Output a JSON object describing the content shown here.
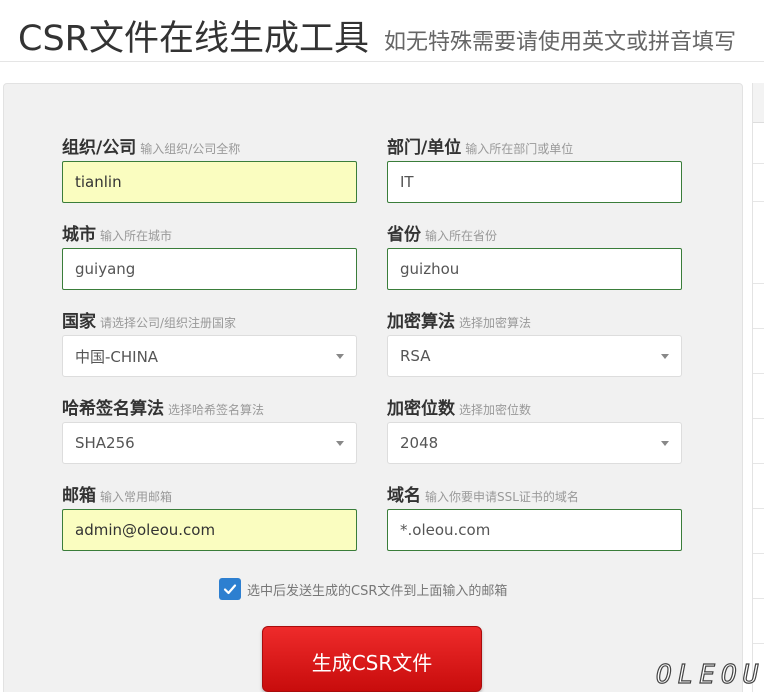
{
  "header": {
    "title": "CSR文件在线生成工具",
    "subtitle": "如无特殊需要请使用英文或拼音填写"
  },
  "form": {
    "org": {
      "label": "组织/公司",
      "hint": "输入组织/公司全称",
      "value": "tianlin"
    },
    "dept": {
      "label": "部门/单位",
      "hint": "输入所在部门或单位",
      "value": "IT"
    },
    "city": {
      "label": "城市",
      "hint": "输入所在城市",
      "value": "guiyang"
    },
    "province": {
      "label": "省份",
      "hint": "输入所在省份",
      "value": "guizhou"
    },
    "country": {
      "label": "国家",
      "hint": "请选择公司/组织注册国家",
      "value": "中国-CHINA"
    },
    "algorithm": {
      "label": "加密算法",
      "hint": "选择加密算法",
      "value": "RSA"
    },
    "hash": {
      "label": "哈希签名算法",
      "hint": "选择哈希签名算法",
      "value": "SHA256"
    },
    "bits": {
      "label": "加密位数",
      "hint": "选择加密位数",
      "value": "2048"
    },
    "email": {
      "label": "邮箱",
      "hint": "输入常用邮箱",
      "value": "admin@oleou.com"
    },
    "domain": {
      "label": "域名",
      "hint": "输入你要申请SSL证书的域名",
      "value": "*.oleou.com"
    },
    "send_email": {
      "label": "选中后发送生成的CSR文件到上面输入的邮箱",
      "checked": true
    },
    "submit_label": "生成CSR文件"
  },
  "watermark": "OLEOU",
  "colors": {
    "accent_red": "#d71414",
    "checkbox_blue": "#2d7fd0",
    "autofill_yellow": "#fafdc0",
    "input_border_green": "#3a7d3a"
  }
}
